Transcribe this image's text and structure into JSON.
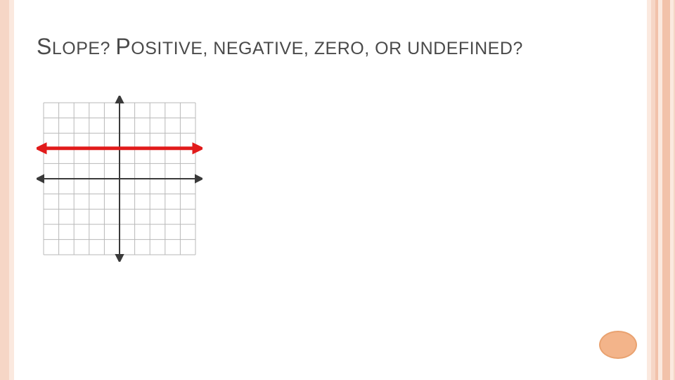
{
  "title": {
    "word1_cap": "S",
    "word1_rest": "LOPE",
    "punct1": "? ",
    "word2_cap": "P",
    "word2_rest": "OSITIVE",
    "punct2": ", ",
    "word3": "NEGATIVE",
    "punct3": ", ",
    "word4": "ZERO",
    "punct4": ", ",
    "word5": "OR UNDEFINED",
    "punct5": "?"
  },
  "chart_data": {
    "type": "line",
    "title": "",
    "xlabel": "",
    "ylabel": "",
    "xlim": [
      -5,
      5
    ],
    "ylim": [
      -5,
      5
    ],
    "grid": true,
    "line": {
      "equation": "y = 2",
      "points": [
        [
          -5,
          2
        ],
        [
          5,
          2
        ]
      ],
      "color": "#e11b1b",
      "arrows": "both"
    },
    "answer": "zero"
  }
}
